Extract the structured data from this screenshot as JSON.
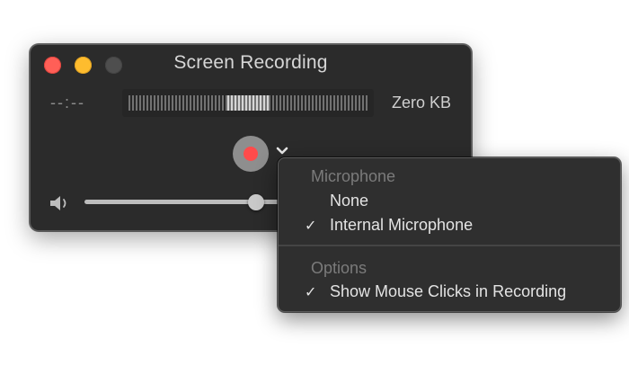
{
  "window": {
    "title": "Screen Recording",
    "elapsed_time": "--:--",
    "file_size": "Zero KB",
    "volume_level": 0.83,
    "icons": {
      "close": "close-traffic-light",
      "minimize": "minimize-traffic-light",
      "zoom": "zoom-traffic-light-disabled",
      "record": "record-icon",
      "options": "chevron-down-icon",
      "volume": "speaker-icon"
    },
    "colors": {
      "close": "#ff5f57",
      "minimize": "#febc2e",
      "zoom_disabled": "#4e4e4e",
      "record_dot": "#ff4b4b"
    }
  },
  "menu": {
    "sections": [
      {
        "header": "Microphone",
        "items": [
          {
            "label": "None",
            "checked": false
          },
          {
            "label": "Internal Microphone",
            "checked": true
          }
        ]
      },
      {
        "header": "Options",
        "items": [
          {
            "label": "Show Mouse Clicks in Recording",
            "checked": true
          }
        ]
      }
    ],
    "check_glyph": "✓"
  }
}
